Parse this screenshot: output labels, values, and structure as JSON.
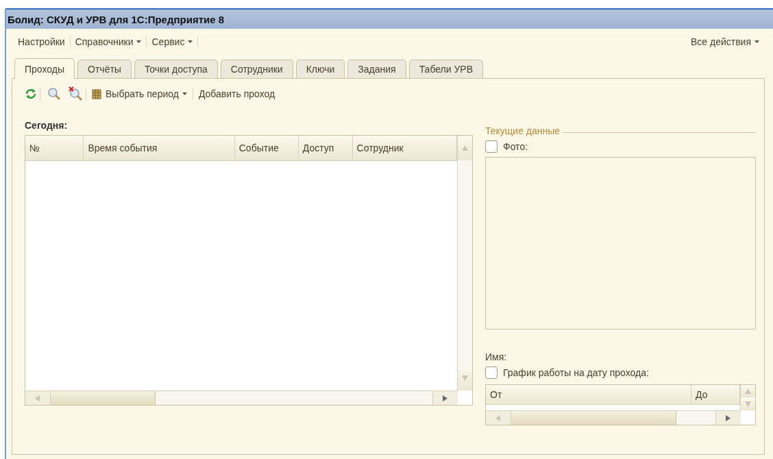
{
  "window": {
    "title": "Болид: СКУД и УРВ для 1С:Предприятие 8"
  },
  "menu": [
    {
      "label": "Настройки",
      "dropdown": false
    },
    {
      "label": "Справочники",
      "dropdown": true
    },
    {
      "label": "Сервис",
      "dropdown": true
    }
  ],
  "all_actions": {
    "label": "Все действия",
    "dropdown": true
  },
  "tabs": [
    {
      "label": "Проходы",
      "selected": true
    },
    {
      "label": "Отчёты",
      "selected": false
    },
    {
      "label": "Точки доступа",
      "selected": false
    },
    {
      "label": "Сотрудники",
      "selected": false
    },
    {
      "label": "Ключи",
      "selected": false
    },
    {
      "label": "Задания",
      "selected": false
    },
    {
      "label": "Табели УРВ",
      "selected": false
    }
  ],
  "toolbar": {
    "period_button": "Выбрать период",
    "add_button": "Добавить проход"
  },
  "today_label": "Сегодня:",
  "table": {
    "columns": [
      "№",
      "Время события",
      "Событие",
      "Доступ",
      "Сотрудник"
    ]
  },
  "current": {
    "title": "Текущие данные",
    "photo": {
      "label": "Фото:",
      "checked": false
    },
    "name_label": "Имя:",
    "schedule": {
      "label": "График работы на дату прохода:",
      "checked": false
    },
    "schedule_columns": [
      "От",
      "До"
    ]
  }
}
